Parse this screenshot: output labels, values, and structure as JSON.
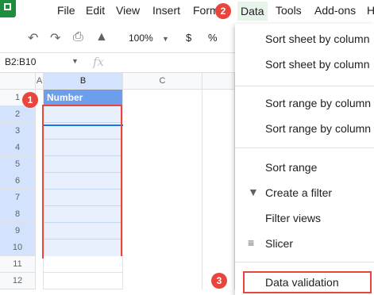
{
  "menubar": {
    "items": [
      "File",
      "Edit",
      "View",
      "Insert",
      "Form",
      "Data",
      "Tools",
      "Add-ons",
      "H"
    ]
  },
  "toolbar": {
    "zoom": "100%",
    "currency": "$",
    "percent": "%",
    "undo_icon": "undo-icon",
    "redo_icon": "redo-icon",
    "print_icon": "print-icon",
    "paint_icon": "paint-format-icon"
  },
  "formula_bar": {
    "range": "B2:B10",
    "fx": "fx"
  },
  "sheet": {
    "columns": [
      "A",
      "B",
      "C"
    ],
    "rows": [
      "1",
      "2",
      "3",
      "4",
      "5",
      "6",
      "7",
      "8",
      "9",
      "10",
      "11",
      "12"
    ],
    "header_cell": "Number"
  },
  "data_menu": {
    "items": [
      "Sort sheet by column",
      "Sort sheet by column",
      "Sort range by column",
      "Sort range by column",
      "Sort range",
      "Create a filter",
      "Filter views",
      "Slicer",
      "Data validation"
    ]
  },
  "callouts": [
    "1",
    "2",
    "3"
  ],
  "colors": {
    "accent": "#e8453c",
    "header_fill": "#6d9eeb",
    "selection": "#e8f0fe",
    "active_menu": "#e6f4ea"
  }
}
